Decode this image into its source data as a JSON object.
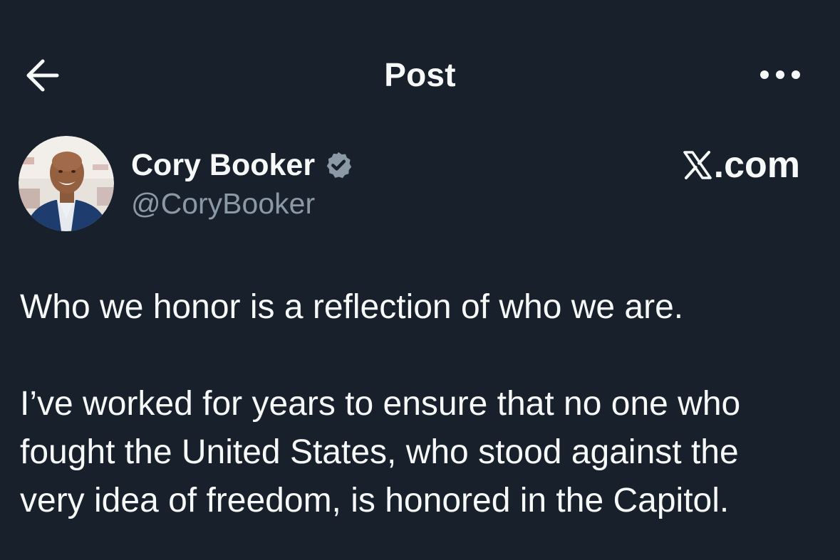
{
  "header": {
    "title": "Post",
    "back_icon": "arrow-left-icon",
    "more_icon": "more-horizontal-icon"
  },
  "author": {
    "display_name": "Cory Booker",
    "handle": "@CoryBooker",
    "verified_icon": "verified-badge-icon",
    "avatar_icon": "profile-photo"
  },
  "site_label": {
    "logo_icon": "x-logo-icon",
    "text": ".com"
  },
  "post": {
    "paragraphs": [
      {
        "lines": [
          "Who we honor is a reflection of who we are."
        ]
      },
      {
        "lines": [
          "I’ve worked for years to ensure that no one who",
          "fought the United States, who stood against the",
          "very idea of freedom, is honored in the Capitol."
        ]
      }
    ]
  },
  "colors": {
    "background": "#17202b",
    "primary_text": "#f7f9f9",
    "secondary_text": "#8b98a5",
    "verified_badge": "#8b98a5"
  }
}
